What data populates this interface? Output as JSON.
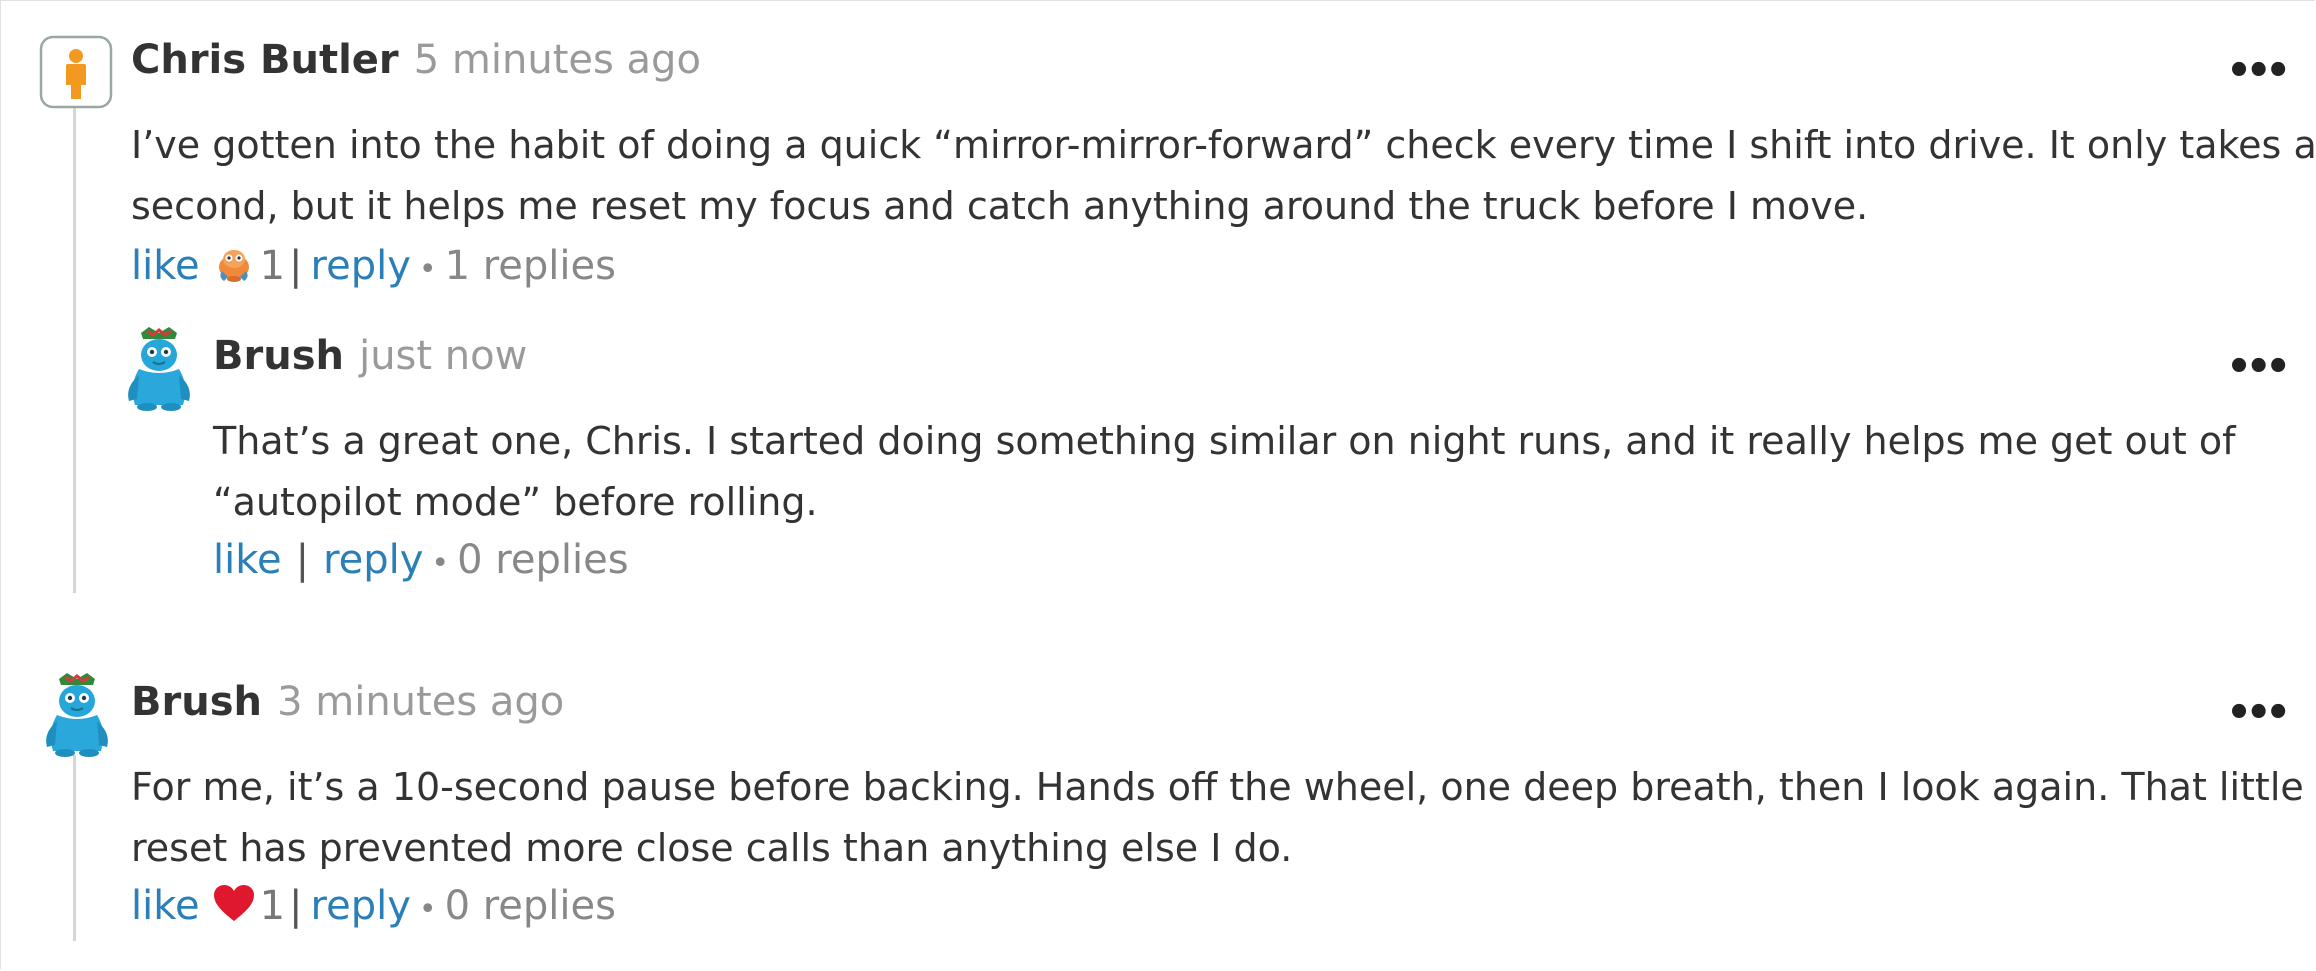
{
  "comments": [
    {
      "author": "Chris Butler",
      "time": "5 minutes ago",
      "body_lines": [
        "I’ve gotten into the habit of doing a quick “mirror-mirror-forward” check every time I shift into drive. It only takes a",
        "second, but it helps me reset my focus and catch anything around the truck before I move."
      ],
      "like_label": "like",
      "like_count": "1",
      "reply_label": "reply",
      "replies_text": "1 replies",
      "reaction_icon": "orange-creature-reaction-icon",
      "avatar_icon": "person-silhouette-avatar-icon",
      "reply": {
        "author": "Brush",
        "time": "just now",
        "body_lines": [
          "That’s a great one, Chris. I started doing something similar on night runs, and it really helps me get out of",
          "“autopilot mode” before rolling."
        ],
        "like_label": "like",
        "reply_label": "reply",
        "replies_text": "0 replies",
        "avatar_icon": "blue-monster-avatar-icon"
      }
    },
    {
      "author": "Brush",
      "time": "3 minutes ago",
      "body_lines": [
        "For me, it’s a 10-second pause before backing. Hands off the wheel, one deep breath, then I look again. That little",
        "reset has prevented more close calls than anything else I do."
      ],
      "like_label": "like",
      "like_count": "1",
      "reply_label": "reply",
      "replies_text": "0 replies",
      "reaction_icon": "heart-reaction-icon",
      "avatar_icon": "blue-monster-avatar-icon"
    }
  ],
  "more_menu_glyph": "•••",
  "separator": "|",
  "dot": "•",
  "colors": {
    "link": "#2a7fb8",
    "timestamp": "#9a9a9a",
    "text": "#333333",
    "avatar_orange": "#f29a1f",
    "avatar_blue": "#27a6d9",
    "heart": "#e0182d"
  }
}
